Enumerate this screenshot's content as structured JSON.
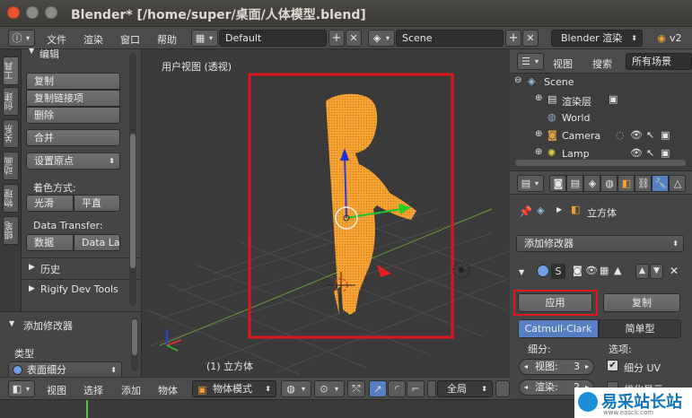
{
  "window": {
    "title": "Blender* [/home/super/桌面/人体模型.blend]"
  },
  "info_header": {
    "menus": [
      "文件",
      "渲染",
      "窗口",
      "帮助"
    ],
    "layout": "Default",
    "scene": "Scene",
    "engine": "Blender 渲染",
    "version": "v2"
  },
  "left_tabs": [
    "工具",
    "创建",
    "关系",
    "动画",
    "物理",
    "蜡笔"
  ],
  "toolshelf": {
    "section_edit": "编辑",
    "duplicate": "复制",
    "duplicate_linked": "复制链接项",
    "delete": "删除",
    "join": "合并",
    "set_origin": "设置原点",
    "shading_label": "着色方式:",
    "smooth": "光滑",
    "flat": "平直",
    "data_transfer_label": "Data Transfer:",
    "data": "数据",
    "data_layout": "Data La",
    "history": "历史",
    "rigify": "Rigify Dev Tools"
  },
  "operator_panel": {
    "title": "添加修改器",
    "type_label": "类型",
    "type_value": "表面细分"
  },
  "viewport": {
    "view_label": "用户视图 (透视)",
    "object_label": "(1) 立方体",
    "highlight_color": "#e0161d",
    "mesh_color": "#f7a333"
  },
  "view3d_header": {
    "menus": [
      "视图",
      "选择",
      "添加",
      "物体"
    ],
    "mode": "物体模式",
    "pivot": "全局"
  },
  "outliner": {
    "view": "视图",
    "search": "搜索",
    "filter": "所有场景",
    "items": [
      "Scene",
      "渲染层",
      "World",
      "Camera",
      "Lamp"
    ]
  },
  "properties": {
    "object_name": "立方体",
    "add_modifier": "添加修改器",
    "apply": "应用",
    "copy": "复制",
    "catmull": "Catmull-Clark",
    "simple": "简单型",
    "subdiv_label": "细分:",
    "view_label": "视图:",
    "view_value": "3",
    "render_label": "渲染:",
    "render_value": "2",
    "options_label": "选项:",
    "subdiv_uv": "细分 UV",
    "optimal_display": "优化显示"
  },
  "watermark": {
    "brand": "易采站长站",
    "url": "www.easck.com"
  }
}
